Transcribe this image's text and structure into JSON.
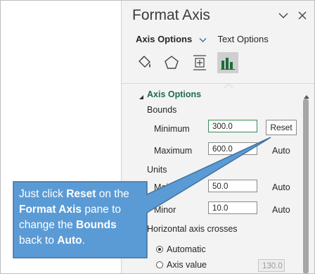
{
  "pane": {
    "title": "Format Axis",
    "tabs": {
      "active": "Axis Options",
      "other": "Text Options"
    },
    "icons": [
      "fill-line-icon",
      "effects-pentagon-icon",
      "size-properties-icon",
      "axis-options-chart-icon"
    ]
  },
  "axis_options": {
    "section_title": "Axis Options",
    "bounds_label": "Bounds",
    "minimum_label": "Minimum",
    "minimum_value": "300.0",
    "maximum_label": "Maximum",
    "maximum_value": "600.0",
    "reset_label": "Reset",
    "auto_label": "Auto",
    "units_label": "Units",
    "major_label": "Major",
    "major_value": "50.0",
    "minor_label": "Minor",
    "minor_value": "10.0",
    "crosses_label": "Horizontal axis crosses",
    "automatic_label": "Automatic",
    "axis_value_label": "Axis value",
    "axis_value_value": "130.0"
  },
  "callout": {
    "line1_a": "Just click ",
    "line1_b": "Reset",
    "line1_c": " on the",
    "line2_a": "Format Axis",
    "line2_b": " pane to",
    "line3_a": "change the ",
    "line3_b": "Bounds",
    "line4_a": "back to ",
    "line4_b": "Auto",
    "line4_c": "."
  },
  "colors": {
    "callout_fill": "#5b9bd5",
    "callout_border": "#41719c",
    "section_green": "#1e6b4f",
    "pane_bg": "#f3f3f3"
  }
}
